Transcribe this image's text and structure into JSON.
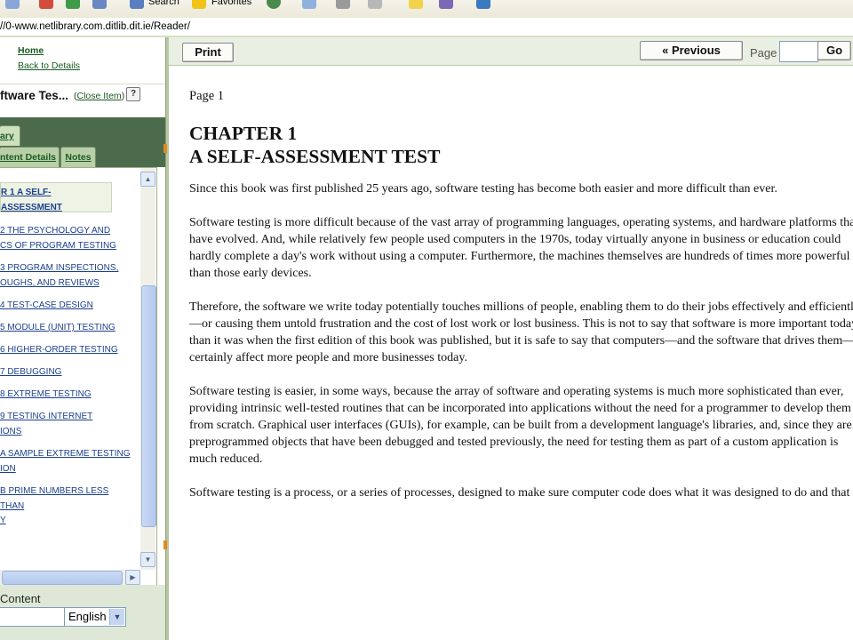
{
  "browser": {
    "toolbar": {
      "search_label": "Search",
      "favorites_label": "Favorites"
    },
    "address": "//0-www.netlibrary.com.ditlib.dit.ie/Reader/"
  },
  "left_panel": {
    "home_link": "Home",
    "back_link": "Back to Details",
    "item_title": "ftware Tes...",
    "close_prefix": "(",
    "close_link": "Close Item",
    "close_suffix": ")",
    "help_icon": "?",
    "tabs": [
      "ary",
      "ntent Details",
      "Notes"
    ],
    "toc": [
      "R 1 A SELF-ASSESSMENT",
      "2 THE PSYCHOLOGY AND\nCS OF PROGRAM TESTING",
      "3 PROGRAM INSPECTIONS,\nOUGHS, AND REVIEWS",
      "4 TEST-CASE DESIGN",
      "5 MODULE (UNIT) TESTING",
      "6 HIGHER-ORDER TESTING",
      "7 DEBUGGING",
      "8 EXTREME TESTING",
      "9 TESTING INTERNET\nIONS",
      "A SAMPLE EXTREME TESTING\nION",
      "B PRIME NUMBERS LESS THAN",
      "Y"
    ],
    "content_label": "Content",
    "language": "English"
  },
  "reader": {
    "print_label": "Print",
    "previous_label": "« Previous",
    "page_label": "Page",
    "page_value": "",
    "go_label": "Go",
    "page_heading": "Page 1",
    "chapter_title": "CHAPTER 1",
    "chapter_subtitle": "A SELF-ASSESSMENT TEST",
    "paragraphs": [
      "Since this book was first published 25 years ago, software testing has become both easier and more difficult than ever.",
      "Software testing is more difficult because of the vast array of programming languages, operating systems, and hardware platforms that have evolved. And, while relatively few people used computers in the 1970s, today virtually anyone in business or education could hardly complete a day's work without using a computer. Furthermore, the machines themselves are hundreds of times more powerful than those early devices.",
      "Therefore, the software we write today potentially touches millions of people, enabling them to do their jobs effectively and efficiently—or causing them untold frustration and the cost of lost work or lost business. This is not to say that software is more important today than it was when the first edition of this book was published, but it is safe to say that computers—and the software that drives them—certainly affect more people and more businesses today.",
      "Software testing is easier, in some ways, because the array of software and operating systems is much more sophisticated than ever, providing intrinsic well-tested routines that can be incorporated into applications without the need for a programmer to develop them from scratch. Graphical user interfaces (GUIs), for example, can be built from a development language's libraries, and, since they are preprogrammed objects that have been debugged and tested previously, the need for testing them as part of a custom application is much reduced.",
      "Software testing is a process, or a series of processes, designed to make sure computer code does what it was designed to do and that it"
    ]
  },
  "colors": {
    "link_green": "#1a5c22",
    "toc_link_blue": "#1a3f8c",
    "tab_bar": "#4c6b4c",
    "toolbar_bg": "#e9efe2"
  }
}
